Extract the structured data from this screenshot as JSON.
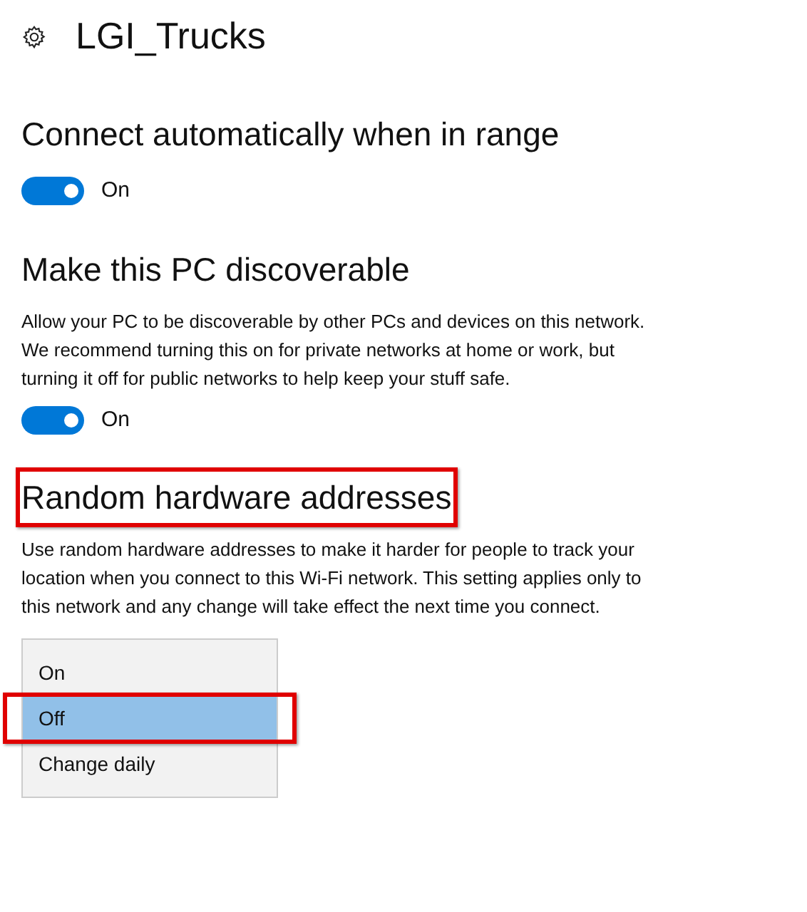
{
  "title": "LGI_Trucks",
  "sections": [
    {
      "kind": "toggle",
      "heading": "Connect automatically when in range",
      "highlighted": false,
      "toggle": {
        "on": true,
        "label": "On"
      }
    },
    {
      "kind": "toggle",
      "heading": "Make this PC discoverable",
      "highlighted": false,
      "description": "Allow your PC to be discoverable by other PCs and devices on this network. We recommend turning this on for private networks at home or work, but turning it off for public networks to help keep your stuff safe.",
      "toggle": {
        "on": true,
        "label": "On"
      }
    },
    {
      "kind": "dropdown",
      "heading": "Random hardware addresses",
      "highlighted": true,
      "description": "Use random hardware addresses to make it harder for people to track your location when you connect to this Wi-Fi network. This setting applies only to this network and any change will take effect the next time you connect.",
      "options": [
        {
          "label": "On",
          "selected": false,
          "highlighted": false
        },
        {
          "label": "Off",
          "selected": true,
          "highlighted": true
        },
        {
          "label": "Change daily",
          "selected": false,
          "highlighted": false
        }
      ]
    }
  ]
}
